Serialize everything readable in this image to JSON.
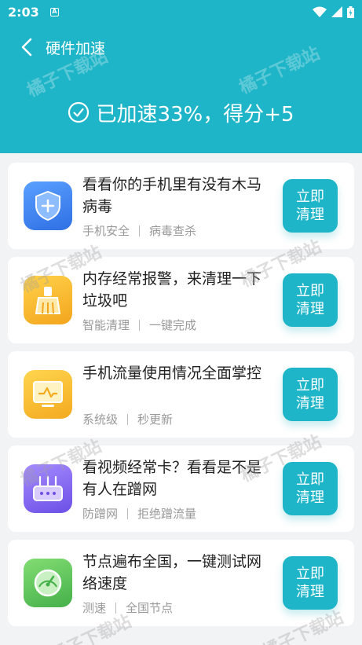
{
  "status": {
    "time": "2:03",
    "notif": "A"
  },
  "nav": {
    "title": "硬件加速"
  },
  "result": {
    "text": "已加速33%，得分+5"
  },
  "watermark": "橘子下载站",
  "items": [
    {
      "title": "看看你的手机里有没有木马病毒",
      "tags": [
        "手机安全",
        "病毒查杀"
      ],
      "action": [
        "立即",
        "清理"
      ],
      "icon": "shield-icon",
      "color": "#3e86f0"
    },
    {
      "title": "内存经常报警，来清理一下垃圾吧",
      "tags": [
        "智能清理",
        "一键完成"
      ],
      "action": [
        "立即",
        "清理"
      ],
      "icon": "broom-icon",
      "color": "#f5b82a"
    },
    {
      "title": "手机流量使用情况全面掌控",
      "tags": [
        "系统级",
        "秒更新"
      ],
      "action": [
        "立即",
        "清理"
      ],
      "icon": "monitor-icon",
      "color": "#f6bd2f"
    },
    {
      "title": "看视频经常卡？看看是不是有人在蹭网",
      "tags": [
        "防蹭网",
        "拒绝蹭流量"
      ],
      "action": [
        "立即",
        "清理"
      ],
      "icon": "router-icon",
      "color": "#8a6cf0"
    },
    {
      "title": "节点遍布全国，一键测试网络速度",
      "tags": [
        "测速",
        "全国节点"
      ],
      "action": [
        "立即",
        "清理"
      ],
      "icon": "speedometer-icon",
      "color": "#5cc65a"
    }
  ]
}
